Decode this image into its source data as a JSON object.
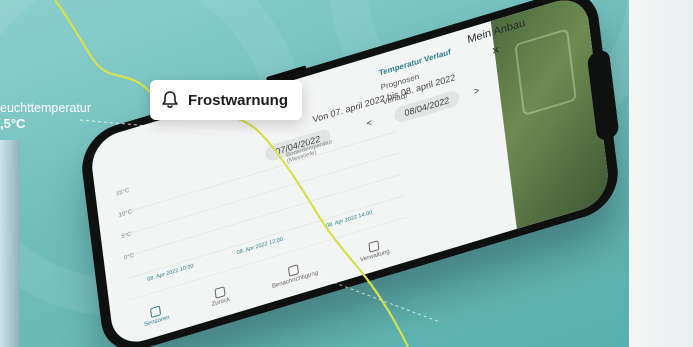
{
  "weather_label": {
    "name": "euchttemperatur",
    "value": ",5°C"
  },
  "alert": {
    "icon": "bell-icon",
    "title": "Frostwarnung"
  },
  "app": {
    "title": "Mein Anbau",
    "close_icon": "close-icon",
    "tabs": [
      {
        "label": "Temperatur\nVerlauf",
        "active": true
      },
      {
        "label": "Prognosen",
        "active": false
      },
      {
        "label": "Verlauf",
        "active": false
      }
    ],
    "date_range_text": "Von 07. april 2022 bis 08. april 2022",
    "date_from": "07/04/2022",
    "date_to": "08/04/2022",
    "arrow_left": "<",
    "arrow_right": ">",
    "chart_label": "Bodentemperatur\n(Messtiefe)",
    "y_ticks": [
      "15°C",
      "10°C",
      "5°C",
      "0°C"
    ],
    "x_ticks": [
      "08. Apr 2022 10:00",
      "08. Apr 2022 12:00",
      "08. Apr 2022 14:00"
    ],
    "bottom_nav": [
      {
        "label": "Sensoren",
        "icon": "sensor-icon",
        "active": true
      },
      {
        "label": "Zurück",
        "icon": "back-icon",
        "active": false
      },
      {
        "label": "Benachrichtigung",
        "icon": "bell-icon",
        "active": false
      },
      {
        "label": "Verwaltung",
        "icon": "menu-icon",
        "active": false
      }
    ]
  },
  "colors": {
    "background": "#6fbebc",
    "accent_line": "#d6e04a",
    "app_accent": "#2f7f88"
  }
}
